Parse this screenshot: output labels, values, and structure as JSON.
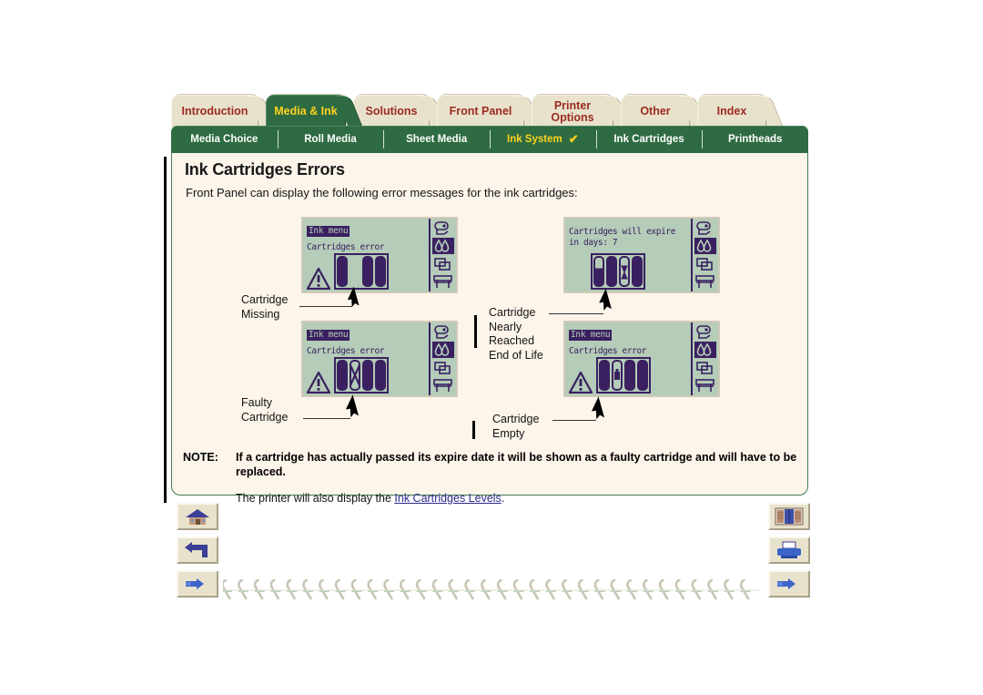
{
  "document": {
    "title": "Ink Cartridges Errors",
    "intro": "Front Panel can display the following error messages for the ink cartridges:"
  },
  "tabs": [
    {
      "label": "Introduction",
      "active": false
    },
    {
      "label": "Media & Ink",
      "active": true
    },
    {
      "label": "Solutions",
      "active": false
    },
    {
      "label": "Front Panel",
      "active": false
    },
    {
      "label": "Printer Options",
      "active": false
    },
    {
      "label": "Other",
      "active": false
    },
    {
      "label": "Index",
      "active": false
    }
  ],
  "tab_labels": {
    "t0": "Introduction",
    "t1": "Media & Ink",
    "t2": "Solutions",
    "t3": "Front Panel",
    "t4a": "Printer",
    "t4b": "Options",
    "t5": "Other",
    "t6": "Index"
  },
  "subnav": {
    "items": [
      {
        "label": "Media Choice",
        "active": false
      },
      {
        "label": "Roll Media",
        "active": false
      },
      {
        "label": "Sheet Media",
        "active": false
      },
      {
        "label": "Ink System",
        "active": true
      },
      {
        "label": "Ink Cartridges",
        "active": false
      },
      {
        "label": "Printheads",
        "active": false
      }
    ],
    "labels": {
      "s0": "Media Choice",
      "s1": "Roll Media",
      "s2": "Sheet Media",
      "s3": "Ink System",
      "s4": "Ink Cartridges",
      "s5": "Printheads"
    },
    "check_glyph": "✔"
  },
  "panels": [
    {
      "id": "cartridge-missing",
      "menu_title": "Ink menu",
      "message": "Cartridges error",
      "has_warning_triangle": true,
      "cartridges": [
        "full",
        "missing",
        "full",
        "full"
      ],
      "callout": "Cartridge\nMissing",
      "callout_line1": "Cartridge",
      "callout_line2": "Missing"
    },
    {
      "id": "cartridge-nearly-end-of-life",
      "menu_title": "",
      "message": "Cartridges will expire\nin days: 7",
      "message_line1": "Cartridges will expire",
      "message_line2": "in days: 7",
      "has_warning_triangle": false,
      "cartridges": [
        "half",
        "full",
        "expiring",
        "full"
      ],
      "callout_line1": "Cartridge",
      "callout_line2": "Nearly",
      "callout_line3": "Reached",
      "callout_line4": "End of Life"
    },
    {
      "id": "faulty-cartridge",
      "menu_title": "Ink menu",
      "message": "Cartridges error",
      "has_warning_triangle": true,
      "cartridges": [
        "full",
        "faulty",
        "full",
        "full"
      ],
      "callout_line1": "Faulty",
      "callout_line2": "Cartridge"
    },
    {
      "id": "cartridge-empty",
      "menu_title": "Ink menu",
      "message": "Cartridges error",
      "has_warning_triangle": true,
      "cartridges": [
        "full",
        "empty",
        "full",
        "full"
      ],
      "callout_line1": "Cartridge",
      "callout_line2": "Empty"
    }
  ],
  "lcd_icons": [
    "roll-media-icon",
    "ink-drops-icon",
    "sheet-media-icon",
    "printer-stand-icon"
  ],
  "note": {
    "label": "NOTE:",
    "text": "If a cartridge has actually passed its expire date it will be shown as a faulty cartridge and will have to be replaced."
  },
  "after_note": {
    "prefix": "The printer will also display the ",
    "link": "Ink Cartridges Levels",
    "suffix": "."
  },
  "buttons": {
    "left": [
      {
        "name": "home-button",
        "icon": "house-icon"
      },
      {
        "name": "back-button",
        "icon": "back-arrow-icon"
      },
      {
        "name": "next-left-button",
        "icon": "pointing-hand-icon"
      }
    ],
    "right": [
      {
        "name": "index-button",
        "icon": "bookshelf-icon"
      },
      {
        "name": "print-button",
        "icon": "printer-icon"
      },
      {
        "name": "next-right-button",
        "icon": "pointing-hand-icon"
      }
    ]
  },
  "colors": {
    "tab_bg": "#e8e2cd",
    "tab_text": "#9c2b20",
    "active_tab_bg": "#2e6b42",
    "active_tab_text": "#ffd21e",
    "panel_bg": "#fdf5ea",
    "lcd_bg": "#b4ccb8",
    "lcd_ink": "#3a2060",
    "link": "#2a2a8c"
  }
}
